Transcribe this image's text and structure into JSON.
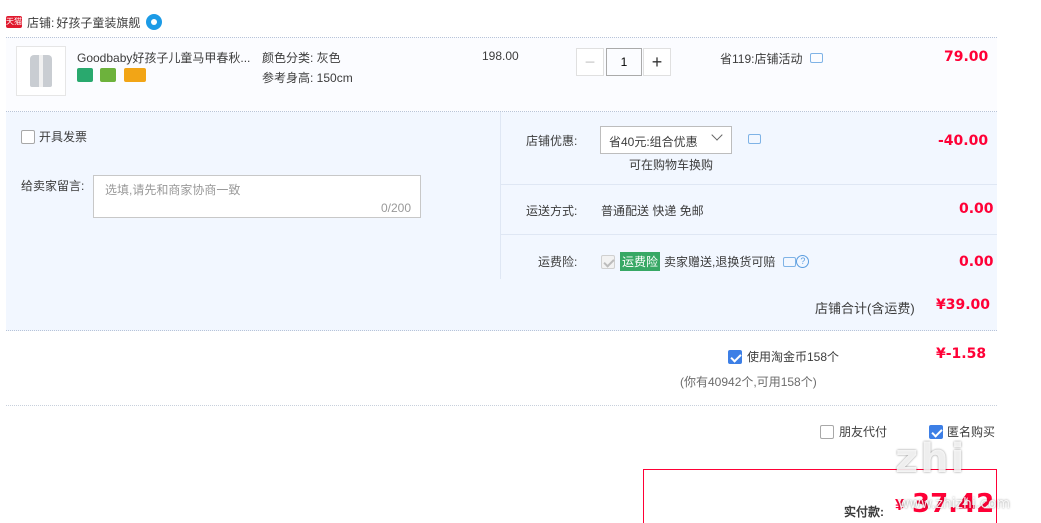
{
  "shop": {
    "badge": "天猫",
    "label": "店铺:",
    "name": "好孩子童装旗舰"
  },
  "item": {
    "title": "Goodbaby好孩子儿童马甲春秋...",
    "spec_color": "颜色分类: 灰色",
    "spec_height": "参考身高: 150cm",
    "unit_price": "198.00",
    "quantity": "1",
    "minus": "−",
    "plus": "+",
    "promo": "省119:店铺活动",
    "subtotal": "79.00"
  },
  "invoice": {
    "label": "开具发票"
  },
  "message": {
    "label": "给卖家留言:",
    "placeholder": "选填,请先和商家协商一致",
    "counter": "0/200"
  },
  "shop_discount": {
    "label": "店铺优惠:",
    "selected": "省40元:组合优惠",
    "hint": "可在购物车换购",
    "amount": "-40.00"
  },
  "shipping": {
    "label": "运送方式:",
    "value": "普通配送 快递 免邮",
    "amount": "0.00"
  },
  "insurance": {
    "label": "运费险:",
    "tag": "运费险",
    "value": "卖家赠送,退换货可赔",
    "help": "?",
    "amount": "0.00"
  },
  "shop_total": {
    "label": "店铺合计(含运费)",
    "amount": "¥39.00"
  },
  "coins": {
    "label": "使用淘金币158个",
    "detail": "(你有40942个,可用158个)",
    "amount": "¥-1.58"
  },
  "options": {
    "friend_pay": "朋友代付",
    "anonymous": "匿名购买"
  },
  "payment": {
    "label": "实付款:",
    "currency": "¥",
    "amount": "37.42"
  },
  "watermark": {
    "text": "zhi",
    "subtext": "www.zhizhi.com"
  },
  "colors": {
    "accent_red": "#ff0036",
    "checkbox_blue": "#3d7fe6",
    "panel_bg": "#f2f7ff"
  }
}
